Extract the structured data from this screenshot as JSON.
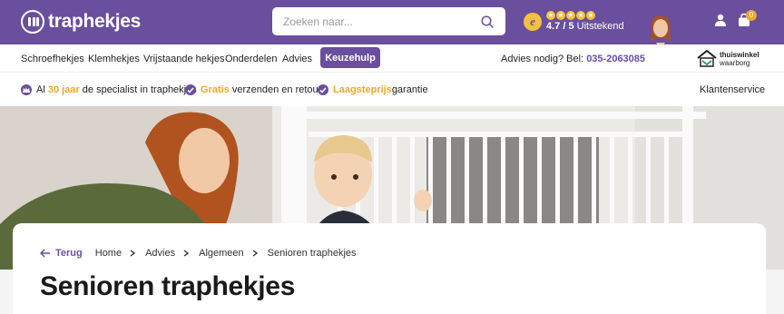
{
  "header": {
    "logo_text": "traphekjes",
    "search_placeholder": "Zoeken naar...",
    "rating": {
      "score": "4.7 / 5",
      "label": "Uitstekend",
      "stars": 5
    },
    "cart_count": "0"
  },
  "nav": {
    "items": [
      "Schroefhekjes",
      "Klemhekjes",
      "Vrijstaande hekjes",
      "Onderdelen",
      "Advies"
    ],
    "cta": "Keuzehulp",
    "advice_prefix": "Advies nodig? Bel:",
    "phone": "035-2063085",
    "badge_line1": "thuiswinkel",
    "badge_line2": "waarborg"
  },
  "usps": {
    "u1_pre": "Al",
    "u1_hl": "30 jaar",
    "u1_post": "de specialist in traphekjes",
    "u2_hl": "Gratis",
    "u2_post": "verzenden en retour*",
    "u3_hl": "Laagsteprijs",
    "u3_post": "garantie",
    "service": "Klantenservice"
  },
  "breadcrumb": {
    "back": "Terug",
    "items": [
      "Home",
      "Advies",
      "Algemeen",
      "Senioren traphekjes"
    ]
  },
  "page": {
    "title": "Senioren traphekjes"
  },
  "colors": {
    "brand": "#6a4f9e",
    "accent": "#f0a826"
  }
}
